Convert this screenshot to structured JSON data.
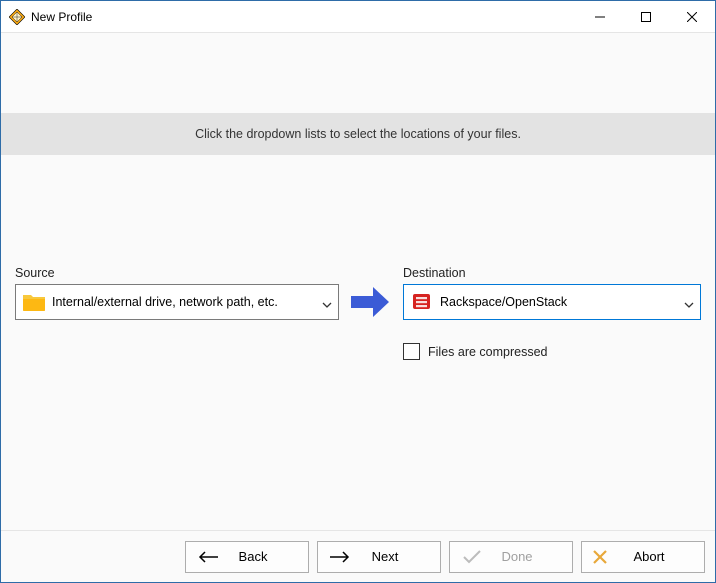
{
  "window": {
    "title": "New Profile"
  },
  "info": {
    "message": "Click the dropdown lists to select the locations of your files."
  },
  "source": {
    "label": "Source",
    "selected": "Internal/external drive, network path, etc."
  },
  "destination": {
    "label": "Destination",
    "selected": "Rackspace/OpenStack"
  },
  "options": {
    "compressed_label": "Files are compressed",
    "compressed_checked": false
  },
  "footer": {
    "back": "Back",
    "next": "Next",
    "done": "Done",
    "abort": "Abort"
  }
}
